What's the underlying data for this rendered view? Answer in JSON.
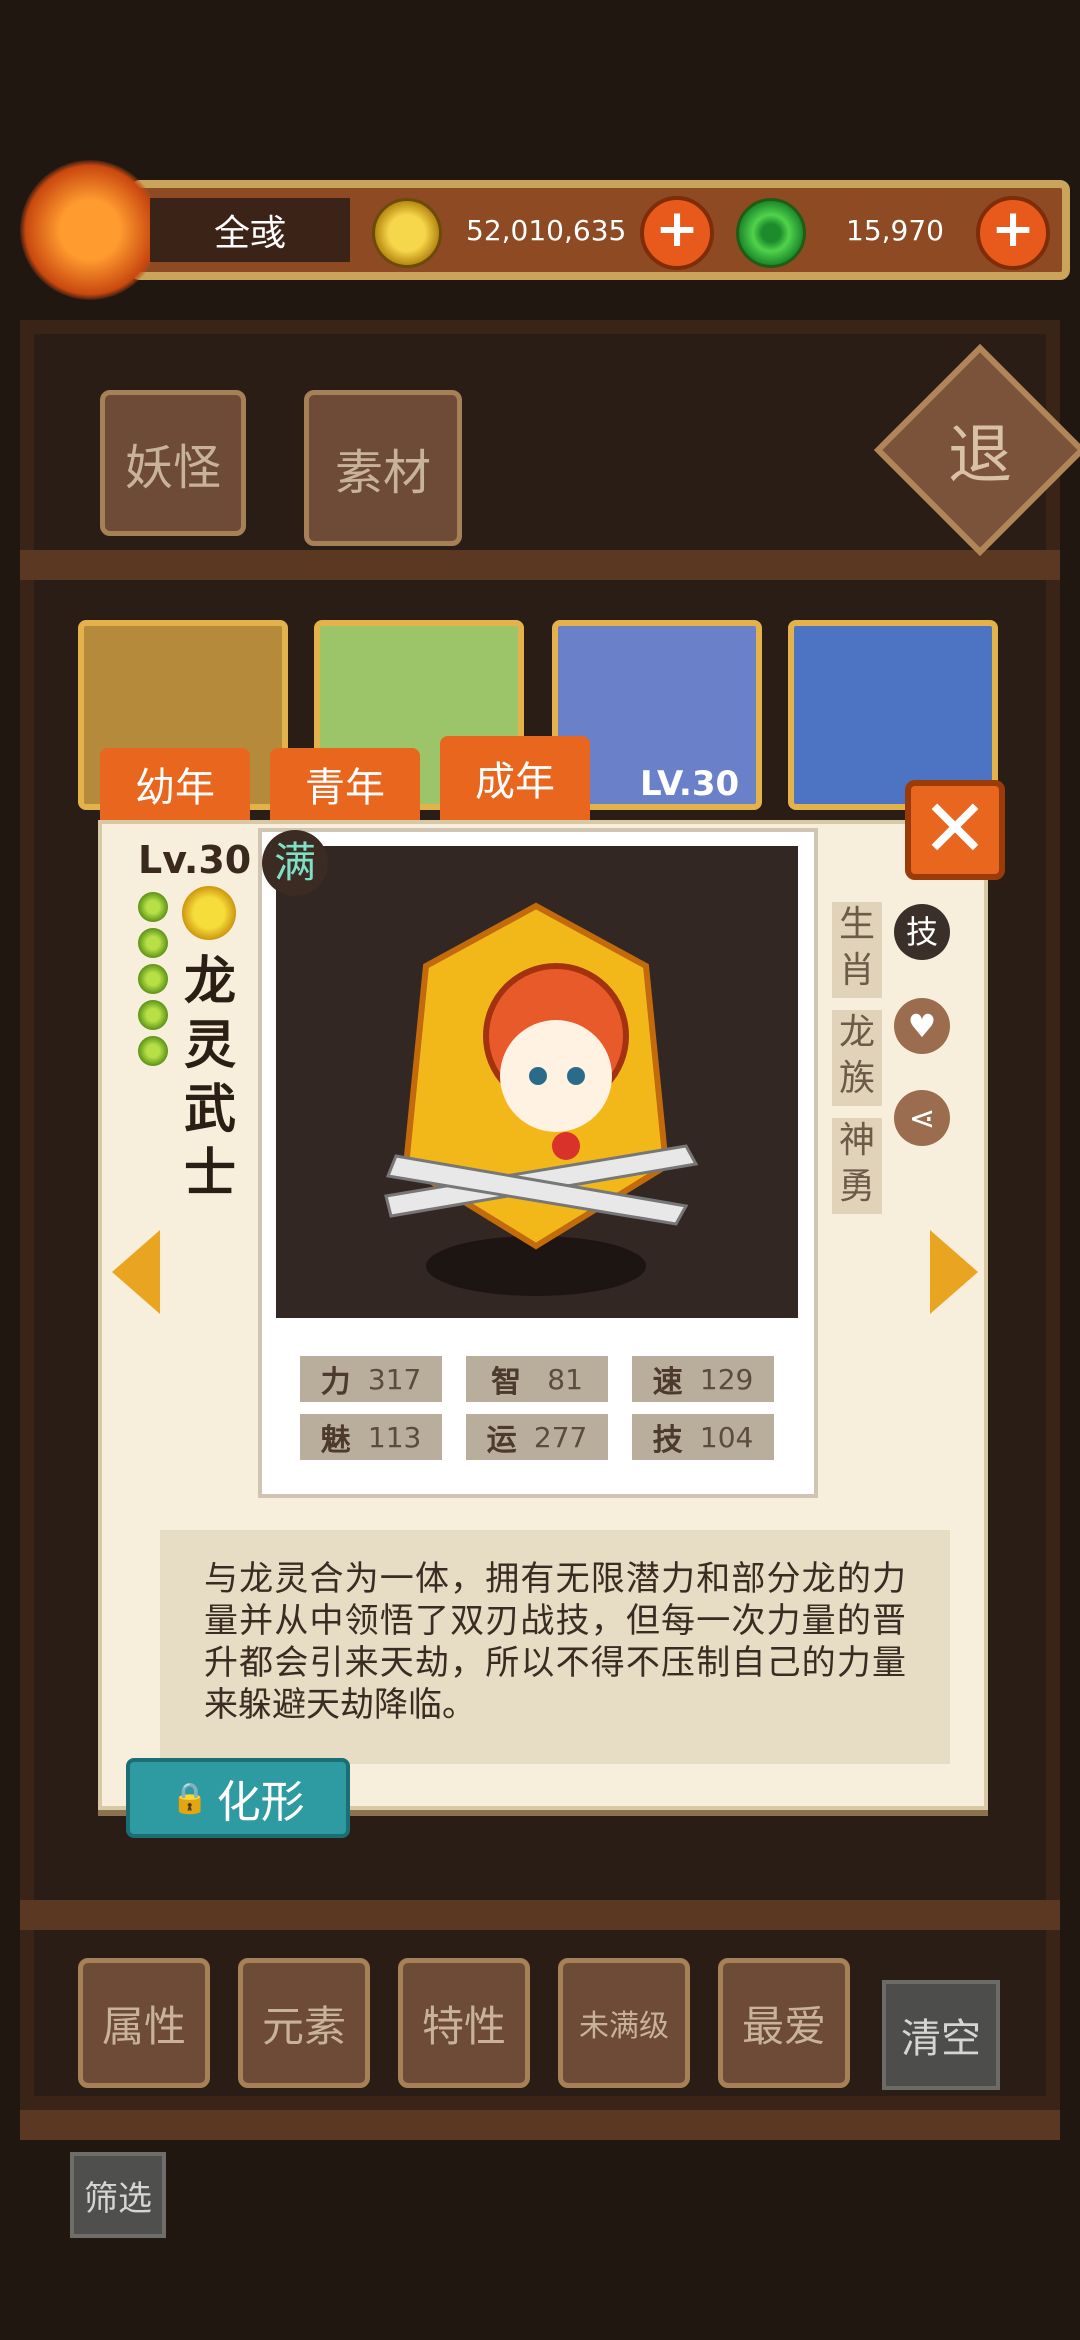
{
  "player": {
    "name": "全彧"
  },
  "currency": {
    "gold": "52,010,635",
    "jade": "15,970",
    "plus": "+"
  },
  "category_tabs": [
    "妖怪",
    "素材"
  ],
  "retreat": "退",
  "age_tabs": [
    "幼年",
    "青年",
    "成年"
  ],
  "selected_age_tab": "成年",
  "background_card_level": "LV.30",
  "close": "✕",
  "monster": {
    "level": "Lv.30",
    "full_badge": "满",
    "name": "龙灵武士",
    "name_chars": [
      "龙",
      "灵",
      "武",
      "士"
    ],
    "tags": [
      "生肖",
      "龙族",
      "神勇"
    ],
    "stats": [
      {
        "label": "力",
        "value": "317"
      },
      {
        "label": "智",
        "value": "81"
      },
      {
        "label": "速",
        "value": "129"
      },
      {
        "label": "魅",
        "value": "113"
      },
      {
        "label": "运",
        "value": "277"
      },
      {
        "label": "技",
        "value": "104"
      }
    ],
    "description": "与龙灵合为一体，拥有无限潜力和部分龙的力量并从中领悟了双刃战技，但每一次力量的晋升都会引来天劫，所以不得不压制自己的力量来躲避天劫降临。"
  },
  "side_icons": {
    "skill": "技"
  },
  "transform_label": "化形",
  "filters": [
    "属性",
    "元素",
    "特性",
    "未满级",
    "最爱"
  ],
  "clear_label": "清空",
  "filter_label": "筛选",
  "colors": {
    "accent_orange": "#e8661d",
    "teal": "#2e9aa1",
    "card": "#f7efdc"
  }
}
